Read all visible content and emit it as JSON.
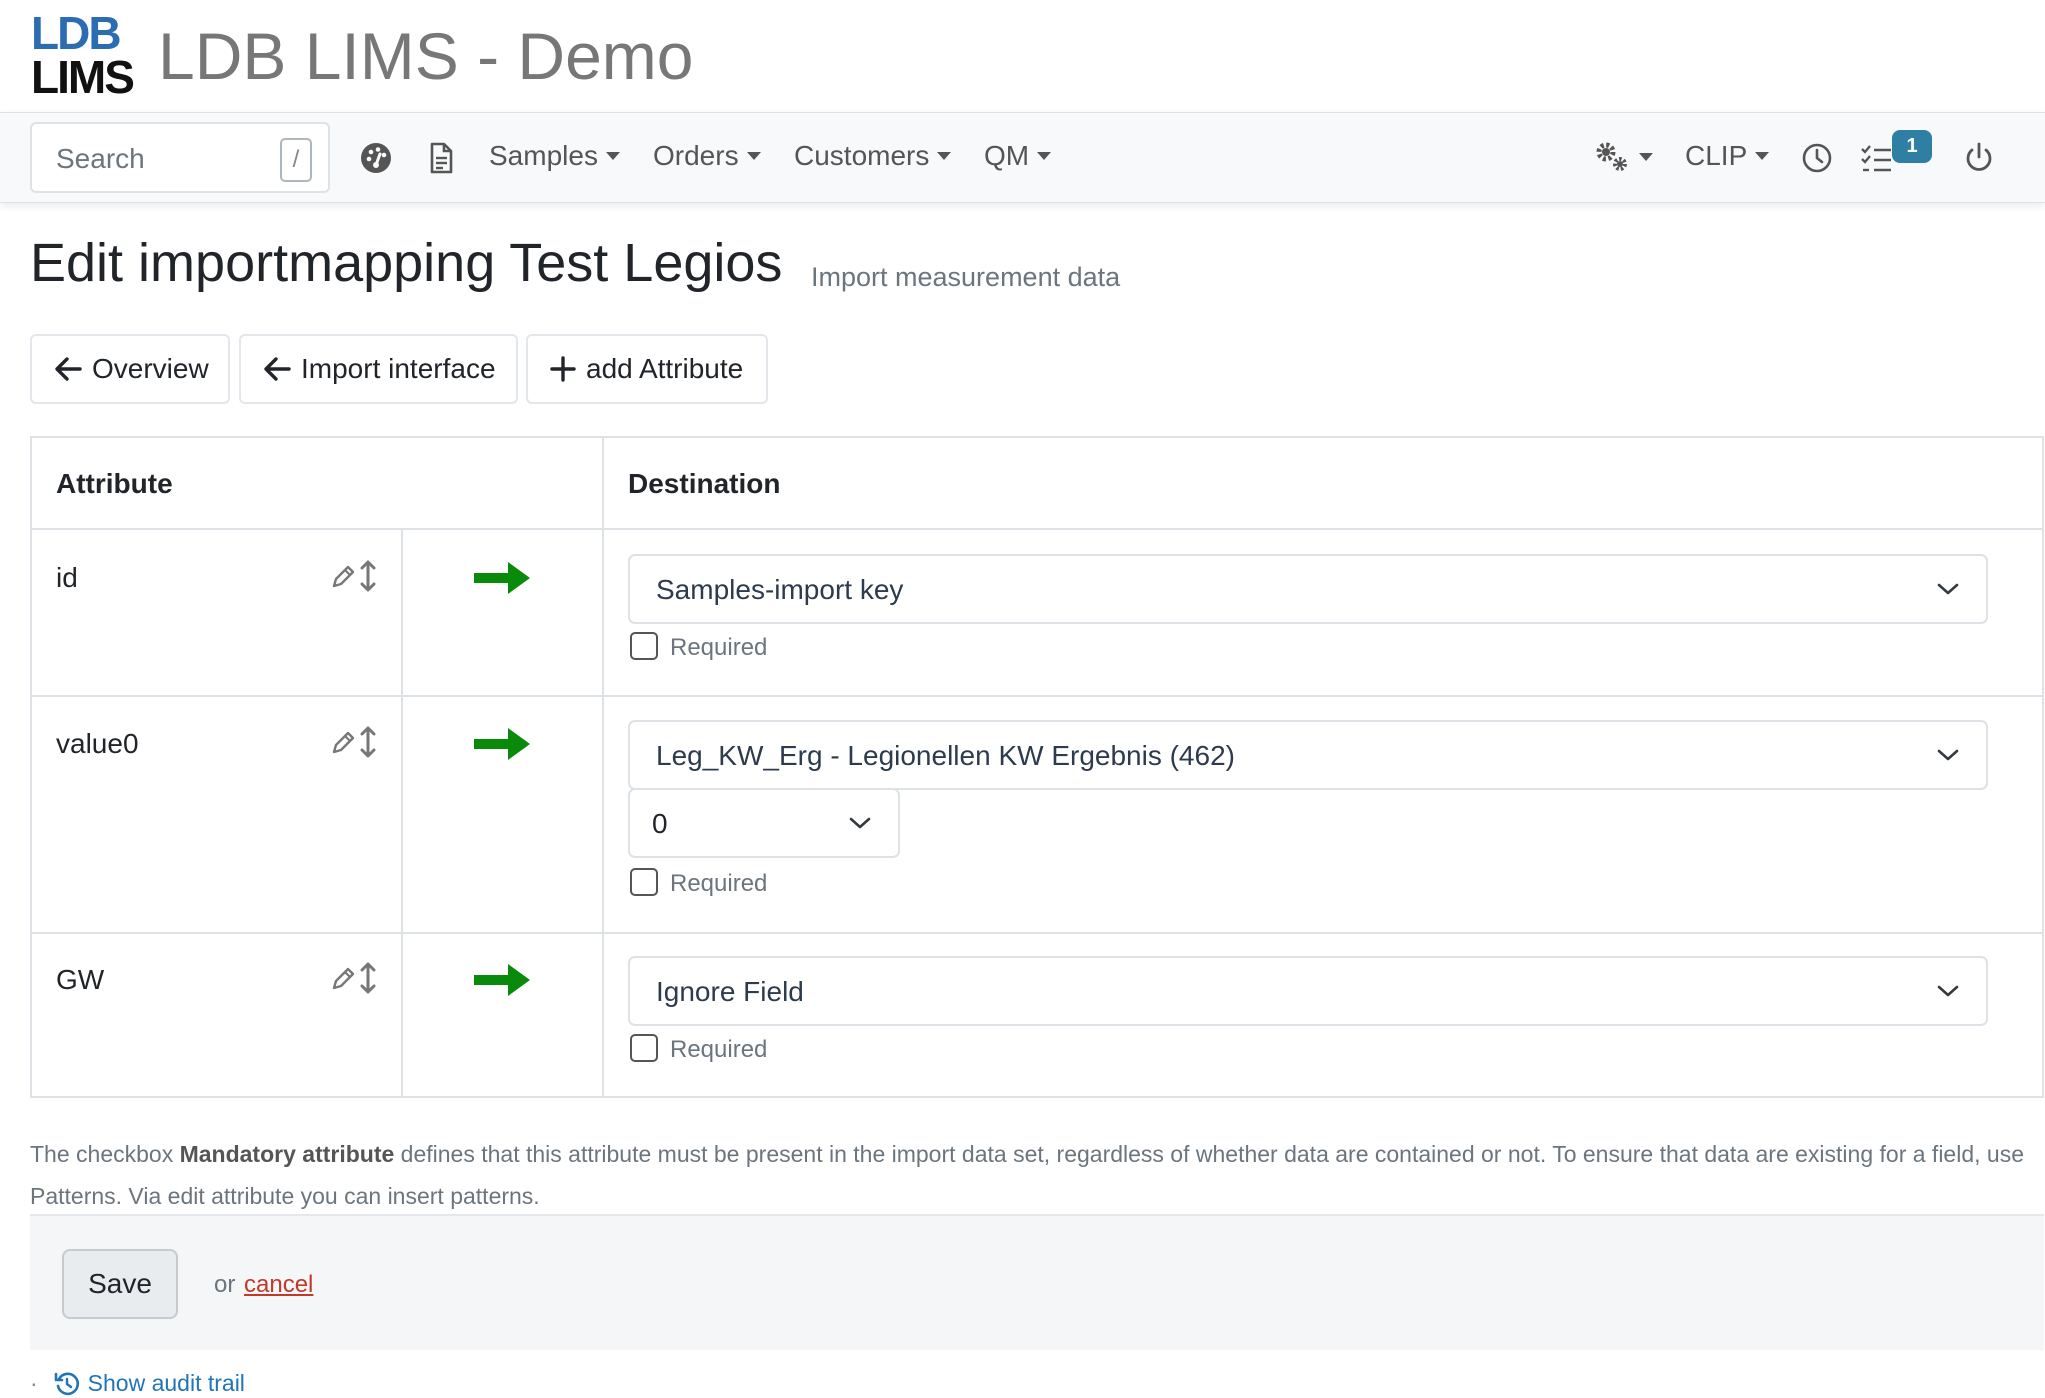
{
  "brand": {
    "logo_line1": "LDB",
    "logo_line2": "LIMS",
    "app_title": "LDB LIMS - Demo"
  },
  "navbar": {
    "search": {
      "placeholder": "Search",
      "shortcut": "/"
    },
    "menus": [
      {
        "label": "Samples"
      },
      {
        "label": "Orders"
      },
      {
        "label": "Customers"
      },
      {
        "label": "QM"
      }
    ],
    "right": {
      "clip_label": "CLIP",
      "tasks_badge": "1"
    }
  },
  "page": {
    "title": "Edit importmapping Test Legios",
    "subtitle": "Import measurement data"
  },
  "buttons": {
    "overview": "Overview",
    "import_interface": "Import interface",
    "add_attribute": "add Attribute"
  },
  "table": {
    "headers": {
      "attribute": "Attribute",
      "destination": "Destination"
    },
    "rows": [
      {
        "attribute": "id",
        "destination": "Samples-import key",
        "required_label": "Required",
        "required": false
      },
      {
        "attribute": "value0",
        "destination": "Leg_KW_Erg - Legionellen KW Ergebnis (462)",
        "index_value": "0",
        "required_label": "Required",
        "required": false
      },
      {
        "attribute": "GW",
        "destination": "Ignore Field",
        "required_label": "Required",
        "required": false
      }
    ]
  },
  "help": {
    "pre": "The checkbox ",
    "bold": "Mandatory attribute",
    "post": " defines that this attribute must be present in the import data set, regardless of whether data are contained or not. To ensure that data are existing for a field, use Patterns. Via edit attribute you can insert patterns."
  },
  "form": {
    "save_label": "Save",
    "or_text": "or",
    "cancel_label": "cancel"
  },
  "audit": {
    "bullet": "·",
    "label": "Show audit trail"
  },
  "colors": {
    "accent_blue": "#2c6cb3",
    "arrow_green": "#0a8a0a",
    "badge": "#2f7fa5",
    "cancel_red": "#c0392b"
  }
}
